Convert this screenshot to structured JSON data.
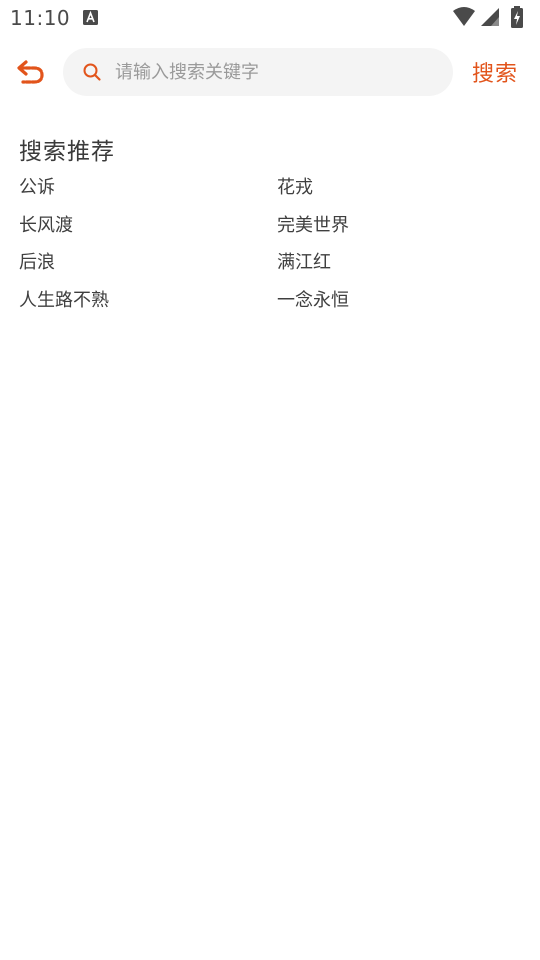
{
  "status_bar": {
    "time": "11:10",
    "icons": [
      "a-icon",
      "wifi-icon",
      "signal-icon",
      "battery-charging-icon"
    ]
  },
  "header": {
    "back_icon": "back-arrow-icon",
    "search_icon": "search-icon",
    "search_placeholder": "请输入搜索关键字",
    "search_value": "",
    "search_button_label": "搜索"
  },
  "recommend": {
    "title": "搜索推荐",
    "items": [
      "公诉",
      "花戎",
      "长风渡",
      "完美世界",
      "后浪",
      "满江红",
      "人生路不熟",
      "一念永恒"
    ]
  },
  "colors": {
    "accent": "#e2541b",
    "search_bg": "#f4f4f4",
    "text": "#3a3a3a"
  }
}
